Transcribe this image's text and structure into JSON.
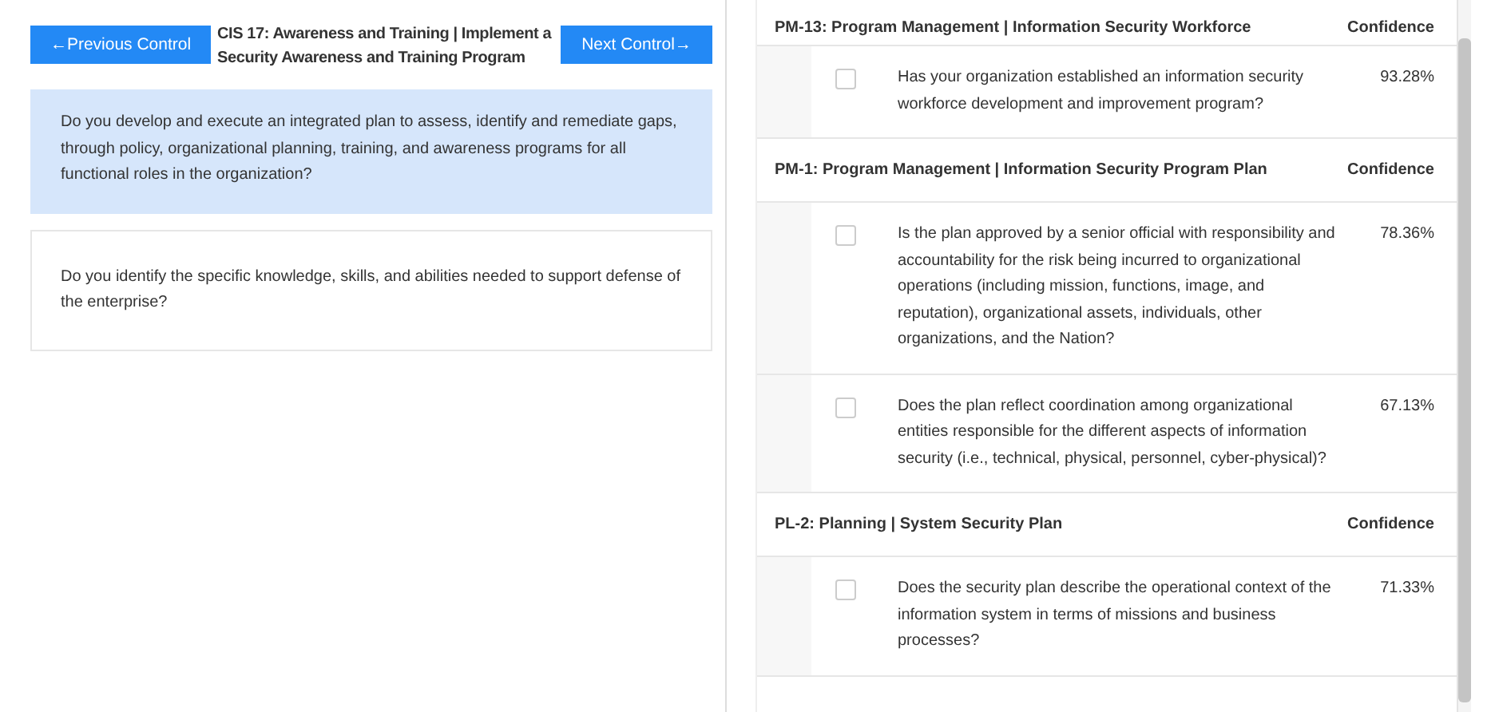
{
  "nav": {
    "previous_button": "←Previous Control",
    "title": "CIS 17: Awareness and Training | Implement a Security Awareness and Training Program",
    "next_button": "Next Control→"
  },
  "questions": [
    {
      "text": "Do you develop and execute an integrated plan to assess, identify and remediate gaps, through policy, organizational planning, training, and awareness programs for all functional roles in the organization?",
      "selected": true
    },
    {
      "text": "Do you identify the specific knowledge, skills, and abilities needed to support defense of the enterprise?",
      "selected": false
    }
  ],
  "controls": [
    {
      "title": "PM-13: Program Management | Information Security Workforce",
      "column": "Confidence",
      "items": [
        {
          "text": "Has your organization established an information security workforce development and improvement program?",
          "confidence": "93.28%",
          "checked": false
        }
      ]
    },
    {
      "title": "PM-1: Program Management | Information Security Program Plan",
      "column": "Confidence",
      "items": [
        {
          "text": "Is the plan approved by a senior official with responsibility and accountability for the risk being incurred to organizational operations (including mission, functions, image, and reputation), organizational assets, individuals, other organizations, and the Nation?",
          "confidence": "78.36%",
          "checked": false
        },
        {
          "text": "Does the plan reflect coordination among organizational entities responsible for the different aspects of information security (i.e., technical, physical, personnel, cyber-physical)?",
          "confidence": "67.13%",
          "checked": false
        }
      ]
    },
    {
      "title": "PL-2: Planning | System Security Plan",
      "column": "Confidence",
      "items": [
        {
          "text": "Does the security plan describe the operational context of the information system in terms of missions and business processes?",
          "confidence": "71.33%",
          "checked": false
        }
      ]
    }
  ]
}
